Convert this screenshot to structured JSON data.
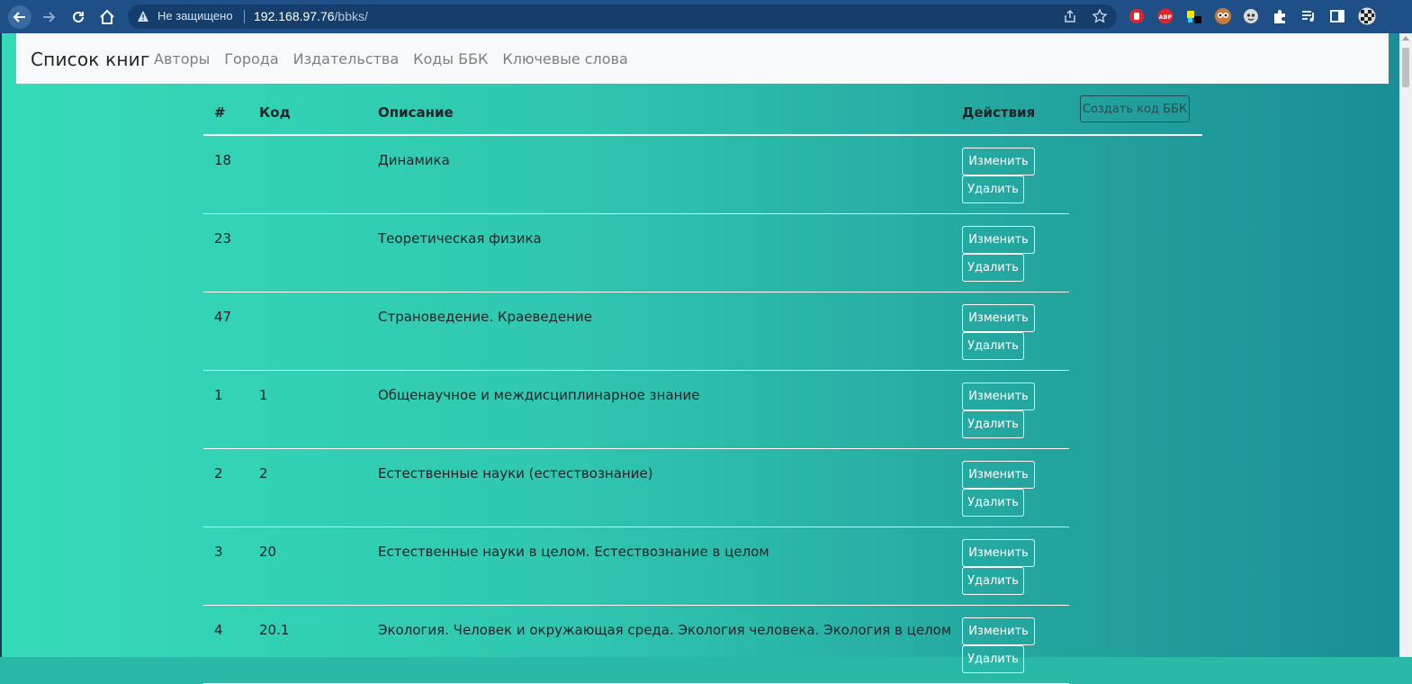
{
  "browser": {
    "security_label": "Не защищено",
    "url_host": "192.168.97.76",
    "url_path": "/bbks/",
    "extensions": [
      "stop-hand-icon",
      "abp-icon",
      "color-squares-icon",
      "owl-icon",
      "ghost-icon",
      "puzzle-icon",
      "playlist-icon",
      "sidebar-icon",
      "profile-avatar"
    ]
  },
  "navbar": {
    "brand": "Список книг",
    "links": [
      "Авторы",
      "Города",
      "Издательства",
      "Коды ББК",
      "Ключевые слова"
    ]
  },
  "table": {
    "headers": [
      "#",
      "Код",
      "Описание",
      "Действия"
    ],
    "create_label": "Создать код ББК",
    "edit_label": "Изменить",
    "delete_label": "Удалить",
    "rows": [
      {
        "id": "18",
        "code": "",
        "desc": "Динамика"
      },
      {
        "id": "23",
        "code": "",
        "desc": "Теоретическая физика"
      },
      {
        "id": "47",
        "code": "",
        "desc": "Страноведение. Краеведение"
      },
      {
        "id": "1",
        "code": "1",
        "desc": "Общенаучное и междисциплинарное знание"
      },
      {
        "id": "2",
        "code": "2",
        "desc": "Естественные науки (естествознание)"
      },
      {
        "id": "3",
        "code": "20",
        "desc": "Естественные науки в целом. Естествознание в целом"
      },
      {
        "id": "4",
        "code": "20.1",
        "desc": "Экология. Человек и окружающая среда. Экология человека. Экология в целом"
      }
    ]
  },
  "colors": {
    "chrome": "#1f4f87",
    "page_gradient_start": "#35dbb9",
    "page_gradient_end": "#1a8e96",
    "navbar_bg": "#f8f9fa"
  }
}
